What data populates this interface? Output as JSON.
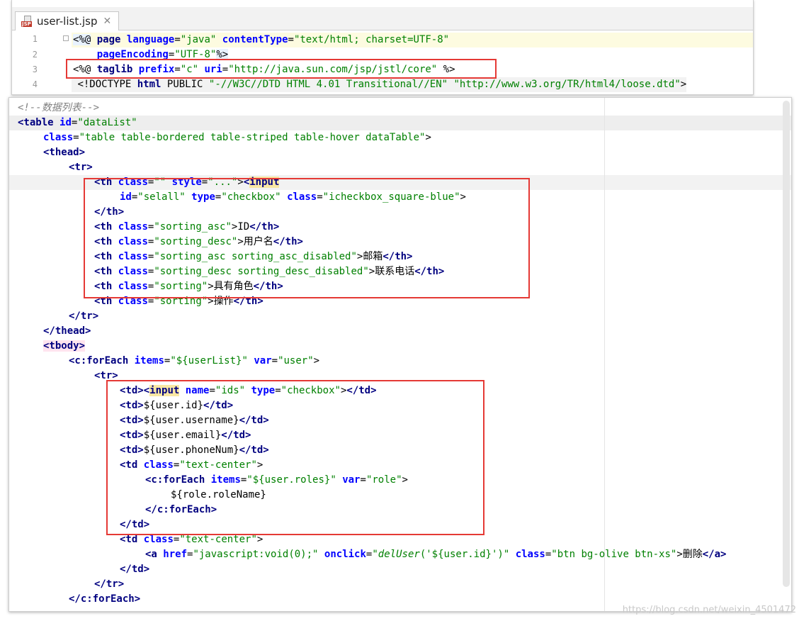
{
  "editor": {
    "tab": {
      "title": "user-list.jsp",
      "icon_label": "JSP"
    },
    "top_lines": [
      {
        "n": "1"
      },
      {
        "n": "2"
      },
      {
        "n": "3"
      },
      {
        "n": "4"
      }
    ],
    "line1": {
      "open": "<%@",
      "page": "page",
      "language": "language",
      "java": "\"java\"",
      "contentType": "contentType",
      "ct": "\"text/html; charset=UTF-8\""
    },
    "line2": {
      "pageEncoding": "pageEncoding",
      "utf": "\"UTF-8\"",
      "close": "%>"
    },
    "line3": {
      "open": "<%@",
      "taglib": "taglib",
      "prefix": "prefix",
      "c": "\"c\"",
      "uri": "uri",
      "url": "\"http://java.sun.com/jsp/jstl/core\"",
      "close": "%>"
    },
    "line4": {
      "doctype": "<!DOCTYPE",
      "html": "html",
      "public": "PUBLIC",
      "dtd": "\"-//W3C//DTD HTML 4.01 Transitional//EN\"",
      "loose": "\"http://www.w3.org/TR/html4/loose.dtd\"",
      "end": ">"
    }
  },
  "main": {
    "comment": "<!--数据列表-->",
    "table_id": "\"dataList\"",
    "table_class": "\"table table-bordered table-striped table-hover dataTable\"",
    "th_style": "\"...\"",
    "selall_id": "\"selall\"",
    "checkbox_type": "\"checkbox\"",
    "checkbox_class": "\"icheckbox_square-blue\"",
    "th_cols": [
      {
        "cls": "\"sorting_asc\"",
        "text": "ID"
      },
      {
        "cls": "\"sorting_desc\"",
        "text": "用户名"
      },
      {
        "cls": "\"sorting_asc sorting_asc_disabled\"",
        "text": "邮箱"
      },
      {
        "cls": "\"sorting_desc sorting_desc_disabled\"",
        "text": "联系电话"
      },
      {
        "cls": "\"sorting\"",
        "text": "具有角色"
      },
      {
        "cls": "\"sorting\"",
        "text": "操作"
      }
    ],
    "foreach_items": "\"${userList}\"",
    "foreach_var": "\"user\"",
    "ids_name": "\"ids\"",
    "td_values": [
      "${user.id}",
      "${user.username}",
      "${user.email}",
      "${user.phoneNum}"
    ],
    "text_center": "\"text-center\"",
    "roles_items": "\"${user.roles}\"",
    "roles_var": "\"role\"",
    "role_name": "${role.roleName}",
    "href_js": "\"javascript:void(0);\"",
    "onclick_fn": "delUser",
    "onclick_arg": "('${user.id}')",
    "btn_class": "\"btn bg-olive btn-xs\"",
    "delete_text": "删除"
  },
  "watermark": "https://blog.csdn.net/weixin_4501472"
}
